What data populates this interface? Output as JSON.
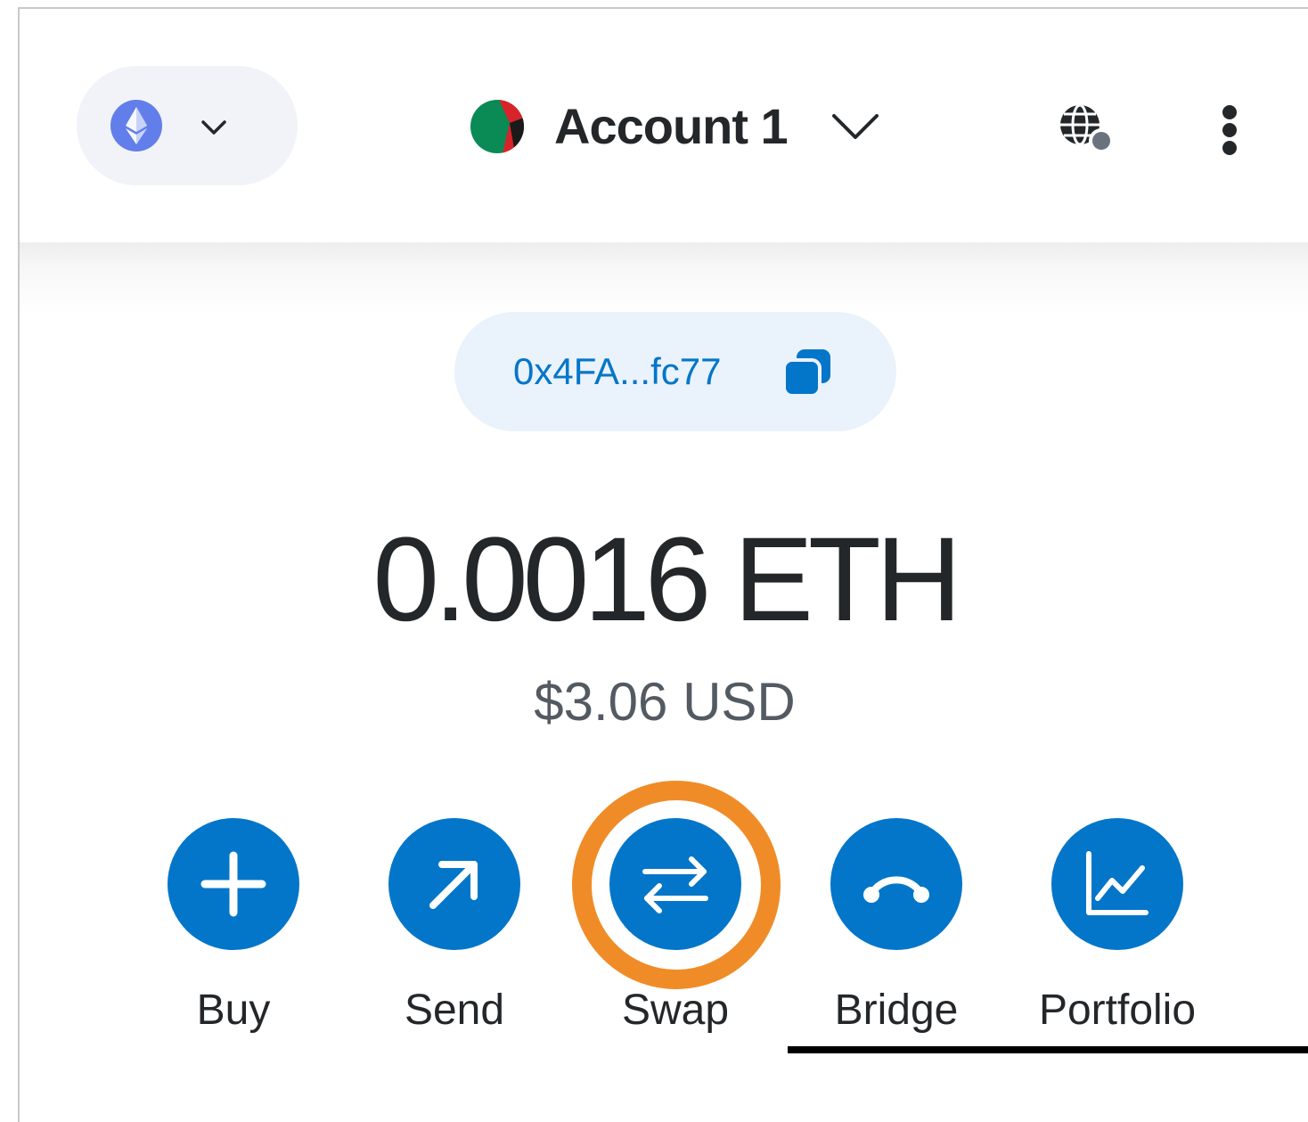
{
  "header": {
    "network": {
      "icon": "ethereum-icon",
      "chevron": "chevron-down-icon"
    },
    "account": {
      "name": "Account 1",
      "avatar_colors": [
        "#0a8a55",
        "#d8232a",
        "#1a1a1a"
      ]
    },
    "connected_sites_icon": "globe-icon",
    "menu_icon": "kebab-menu-icon"
  },
  "address": {
    "short": "0x4FA...fc77",
    "icon": "copy-icon"
  },
  "balance": {
    "primary": "0.0016 ETH",
    "secondary": "$3.06 USD"
  },
  "actions": [
    {
      "label": "Buy",
      "icon": "plus-icon"
    },
    {
      "label": "Send",
      "icon": "arrow-up-right-icon"
    },
    {
      "label": "Swap",
      "icon": "swap-arrows-icon",
      "highlighted": true
    },
    {
      "label": "Bridge",
      "icon": "bridge-icon"
    },
    {
      "label": "Portfolio",
      "icon": "chart-line-icon"
    }
  ],
  "colors": {
    "primary": "#0376c9",
    "highlight": "#f08c27",
    "text": "#24272a",
    "muted_text": "#535a61",
    "pill_bg": "#f1f3f8",
    "address_bg": "#eaf2fb",
    "ethereum": "#627eea"
  }
}
